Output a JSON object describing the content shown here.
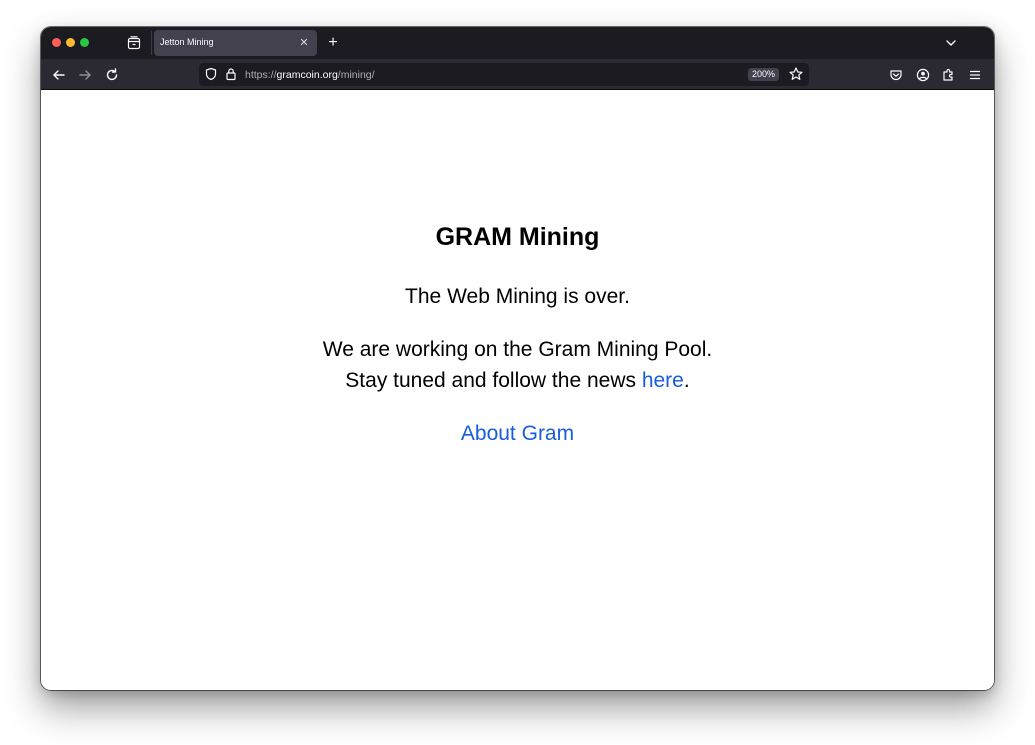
{
  "browser": {
    "tabs": [
      {
        "title": "Jetton Mining",
        "active": true
      }
    ],
    "url": {
      "scheme": "https://",
      "host": "gramcoin.org",
      "path": "/mining/"
    },
    "zoom": "200%",
    "icons": {
      "tab_list": "tab-list-icon",
      "tab_close": "close-icon",
      "new_tab": "plus-icon",
      "tabs_overflow": "chevron-down-icon",
      "back": "back-arrow-icon",
      "forward": "forward-arrow-icon",
      "reload": "reload-icon",
      "tracking_protection": "shield-icon",
      "lock": "lock-icon",
      "bookmark": "star-icon",
      "pocket": "pocket-icon",
      "account": "account-icon",
      "extensions": "extensions-icon",
      "menu": "hamburger-menu-icon"
    },
    "colors": {
      "tab_strip": "#1c1b22",
      "toolbar": "#2b2a33",
      "active_tab": "#42414d",
      "close_dot": "#fe5f57",
      "minimize_dot": "#febc2e",
      "zoom_dot": "#28c840"
    }
  },
  "page": {
    "title": "GRAM Mining",
    "line1": "The Web Mining is over.",
    "line2": "We are working on the Gram Mining Pool.",
    "line3_prefix": "Stay tuned and follow the news ",
    "line3_link": "here",
    "line3_suffix": ".",
    "about_link": "About Gram",
    "link_color": "#1a5ddb"
  }
}
